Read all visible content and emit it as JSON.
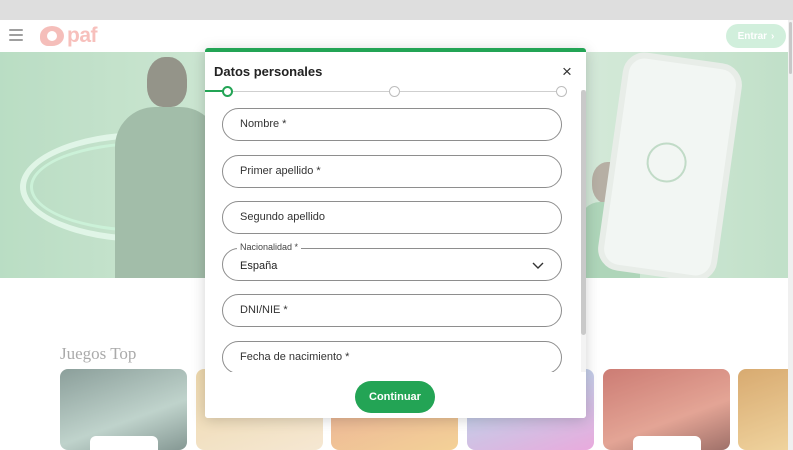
{
  "header": {
    "logo_text": "paf",
    "login_label": "Entrar",
    "login_chevron": "›"
  },
  "page": {
    "games_title": "Juegos Top"
  },
  "modal": {
    "title": "Datos personales",
    "close_glyph": "×",
    "steps_total": 3,
    "current_step": 1,
    "fields": [
      {
        "placeholder": "Nombre *"
      },
      {
        "placeholder": "Primer apellido *"
      },
      {
        "placeholder": "Segundo apellido"
      },
      {
        "label": "Nacionalidad *",
        "value": "España"
      },
      {
        "placeholder": "DNI/NIE *"
      },
      {
        "placeholder": "Fecha de nacimiento *"
      }
    ],
    "continue_label": "Continuar"
  },
  "colors": {
    "accent": "#23a455",
    "logo": "#f4a8a3"
  }
}
